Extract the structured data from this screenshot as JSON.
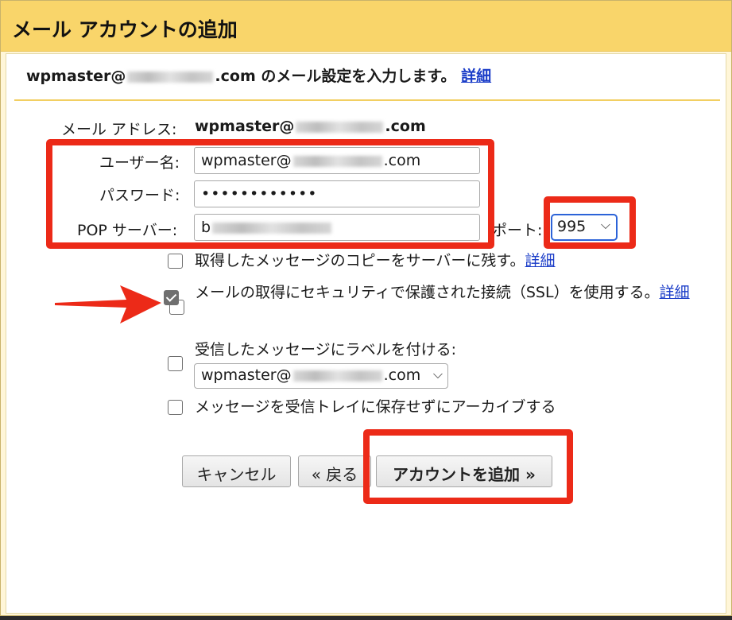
{
  "dialog": {
    "title": "メール アカウントの追加",
    "intro_prefix": "wpmaster@",
    "intro_suffix": ".com のメール設定を入力します。",
    "intro_link": "詳細"
  },
  "form": {
    "email_label": "メール アドレス:",
    "email_prefix": "wpmaster@",
    "email_suffix": ".com",
    "username_label": "ユーザー名:",
    "username_prefix": "wpmaster@",
    "username_suffix": ".com",
    "password_label": "パスワード:",
    "password_value": "••••••••••••",
    "pop_label": "POP サーバー:",
    "pop_prefix": "b",
    "port_label": "ポート:",
    "port_value": "995"
  },
  "options": {
    "leave_copy": {
      "label": "取得したメッセージのコピーをサーバーに残す。",
      "link": "詳細",
      "checked": false
    },
    "ssl": {
      "label": "メールの取得にセキュリティで保護された接続（SSL）を使用する。",
      "link": "詳細",
      "checked": true
    },
    "apply_label": {
      "label": "受信したメッセージにラベルを付ける:",
      "select_prefix": "wpmaster@",
      "select_suffix": ".com",
      "checked": false
    },
    "archive": {
      "label": "メッセージを受信トレイに保存せずにアーカイブする",
      "checked": false
    }
  },
  "buttons": {
    "cancel": "キャンセル",
    "back": "« 戻る",
    "add": "アカウントを追加 »"
  },
  "icons": {
    "chevron": "chevron-down-icon",
    "arrow": "arrow-right-icon"
  },
  "colors": {
    "titlebar": "#f9d56a",
    "highlight": "#ec2a18",
    "link": "#1a3cc8"
  }
}
